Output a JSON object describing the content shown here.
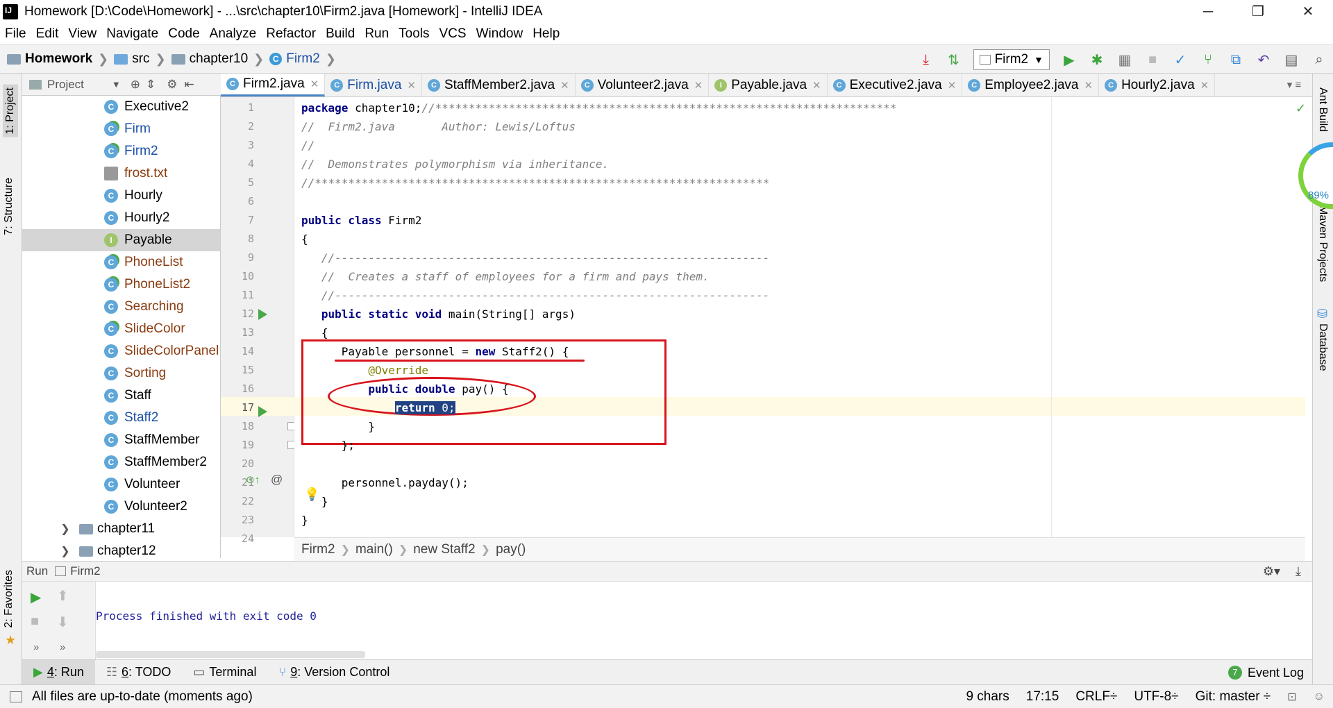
{
  "window": {
    "title": "Homework [D:\\Code\\Homework] - ...\\src\\chapter10\\Firm2.java [Homework] - IntelliJ IDEA",
    "minimize": "─",
    "restore": "❐",
    "close": "✕"
  },
  "menu": [
    "File",
    "Edit",
    "View",
    "Navigate",
    "Code",
    "Analyze",
    "Refactor",
    "Build",
    "Run",
    "Tools",
    "VCS",
    "Window",
    "Help"
  ],
  "breadcrumb": {
    "project": "Homework",
    "src": "src",
    "package": "chapter10",
    "file": "Firm2"
  },
  "toolbar": {
    "run_config": "Firm2"
  },
  "left_tabs": {
    "project": "1: Project",
    "structure": "7: Structure",
    "favorites": "2: Favorites"
  },
  "project_panel": {
    "title": "Project",
    "items": [
      {
        "label": "Executive2",
        "kind": "class",
        "color": "#000000"
      },
      {
        "label": "Firm",
        "kind": "class-run",
        "color": "#1a4fa3"
      },
      {
        "label": "Firm2",
        "kind": "class-run",
        "color": "#1a4fa3"
      },
      {
        "label": "frost.txt",
        "kind": "text",
        "color": "#8a3b10"
      },
      {
        "label": "Hourly",
        "kind": "class",
        "color": "#000000"
      },
      {
        "label": "Hourly2",
        "kind": "class",
        "color": "#000000"
      },
      {
        "label": "Payable",
        "kind": "interface",
        "color": "#000000"
      },
      {
        "label": "PhoneList",
        "kind": "class-run",
        "color": "#8a3b10"
      },
      {
        "label": "PhoneList2",
        "kind": "class-run",
        "color": "#8a3b10"
      },
      {
        "label": "Searching",
        "kind": "class",
        "color": "#8a3b10"
      },
      {
        "label": "SlideColor",
        "kind": "class-run",
        "color": "#8a3b10"
      },
      {
        "label": "SlideColorPanel",
        "kind": "class",
        "color": "#8a3b10"
      },
      {
        "label": "Sorting",
        "kind": "class",
        "color": "#8a3b10"
      },
      {
        "label": "Staff",
        "kind": "class",
        "color": "#000000"
      },
      {
        "label": "Staff2",
        "kind": "class",
        "color": "#1a4fa3"
      },
      {
        "label": "StaffMember",
        "kind": "class",
        "color": "#000000"
      },
      {
        "label": "StaffMember2",
        "kind": "class",
        "color": "#000000"
      },
      {
        "label": "Volunteer",
        "kind": "class",
        "color": "#000000"
      },
      {
        "label": "Volunteer2",
        "kind": "class",
        "color": "#000000"
      }
    ],
    "folders": [
      "chapter11",
      "chapter12"
    ],
    "selected": "Payable"
  },
  "editor_tabs": [
    {
      "label": "Firm2.java",
      "active": true,
      "icon": "class"
    },
    {
      "label": "Firm.java",
      "active": false,
      "icon": "class"
    },
    {
      "label": "StaffMember2.java",
      "active": false,
      "icon": "class"
    },
    {
      "label": "Volunteer2.java",
      "active": false,
      "icon": "class"
    },
    {
      "label": "Payable.java",
      "active": false,
      "icon": "interface"
    },
    {
      "label": "Executive2.java",
      "active": false,
      "icon": "class"
    },
    {
      "label": "Employee2.java",
      "active": false,
      "icon": "class"
    },
    {
      "label": "Hourly2.java",
      "active": false,
      "icon": "class"
    }
  ],
  "code": {
    "current_line": 17,
    "lines": [
      [
        {
          "t": "package",
          "c": "kw"
        },
        {
          "t": " chapter10;"
        },
        {
          "t": "//*********************************************************************",
          "c": "cm"
        }
      ],
      [
        {
          "t": "//  Firm2.java       Author: Lewis/Loftus",
          "c": "cm"
        }
      ],
      [
        {
          "t": "//",
          "c": "cm"
        }
      ],
      [
        {
          "t": "//  Demonstrates polymorphism via inheritance.",
          "c": "cm"
        }
      ],
      [
        {
          "t": "//********************************************************************",
          "c": "cm"
        }
      ],
      [],
      [
        {
          "t": "public class",
          "c": "kw"
        },
        {
          "t": " Firm2"
        }
      ],
      [
        {
          "t": "{"
        }
      ],
      [
        {
          "t": "   "
        },
        {
          "t": "//-----------------------------------------------------------------",
          "c": "cm"
        }
      ],
      [
        {
          "t": "   "
        },
        {
          "t": "//  Creates a staff of employees for a firm and pays them.",
          "c": "cm"
        }
      ],
      [
        {
          "t": "   "
        },
        {
          "t": "//-----------------------------------------------------------------",
          "c": "cm"
        }
      ],
      [
        {
          "t": "   "
        },
        {
          "t": "public static void",
          "c": "kw"
        },
        {
          "t": " main(String[] args)"
        }
      ],
      [
        {
          "t": "   {"
        }
      ],
      [
        {
          "t": "      Payable personnel = "
        },
        {
          "t": "new",
          "c": "kw"
        },
        {
          "t": " Staff2() {"
        }
      ],
      [
        {
          "t": "          "
        },
        {
          "t": "@Override",
          "c": "ann"
        }
      ],
      [
        {
          "t": "          "
        },
        {
          "t": "public double",
          "c": "kw"
        },
        {
          "t": " pay() {"
        }
      ],
      [
        {
          "t": "              "
        },
        {
          "t": "return",
          "c": "kw sel"
        },
        {
          "t": " 0;",
          "c": "sel"
        }
      ],
      [
        {
          "t": "          }"
        }
      ],
      [
        {
          "t": "      };"
        }
      ],
      [],
      [
        {
          "t": "      personnel.payday();"
        }
      ],
      [
        {
          "t": "   }"
        }
      ],
      [
        {
          "t": "}"
        }
      ],
      []
    ]
  },
  "code_breadcrumb": [
    "Firm2",
    "main()",
    "new Staff2",
    "pay()"
  ],
  "right_tabs": {
    "ant": "Ant Build",
    "maven": "Maven Projects",
    "database": "Database"
  },
  "gauge": {
    "percent": "89%"
  },
  "run_panel": {
    "label": "Run",
    "config": "Firm2",
    "output": "Process finished with exit code 0"
  },
  "bottom_tabs": [
    {
      "num": "4",
      "rest": ": Run",
      "active": true
    },
    {
      "num": "6",
      "rest": ": TODO",
      "active": false
    },
    {
      "num": "",
      "rest": "Terminal",
      "active": false
    },
    {
      "num": "9",
      "rest": ": Version Control",
      "active": false
    }
  ],
  "event_log": {
    "count": "7",
    "label": "Event Log"
  },
  "status": {
    "message": "All files are up-to-date (moments ago)",
    "chars": "9 chars",
    "position": "17:15",
    "line_sep": "CRLF÷",
    "encoding": "UTF-8÷",
    "git": "Git: master ÷"
  }
}
